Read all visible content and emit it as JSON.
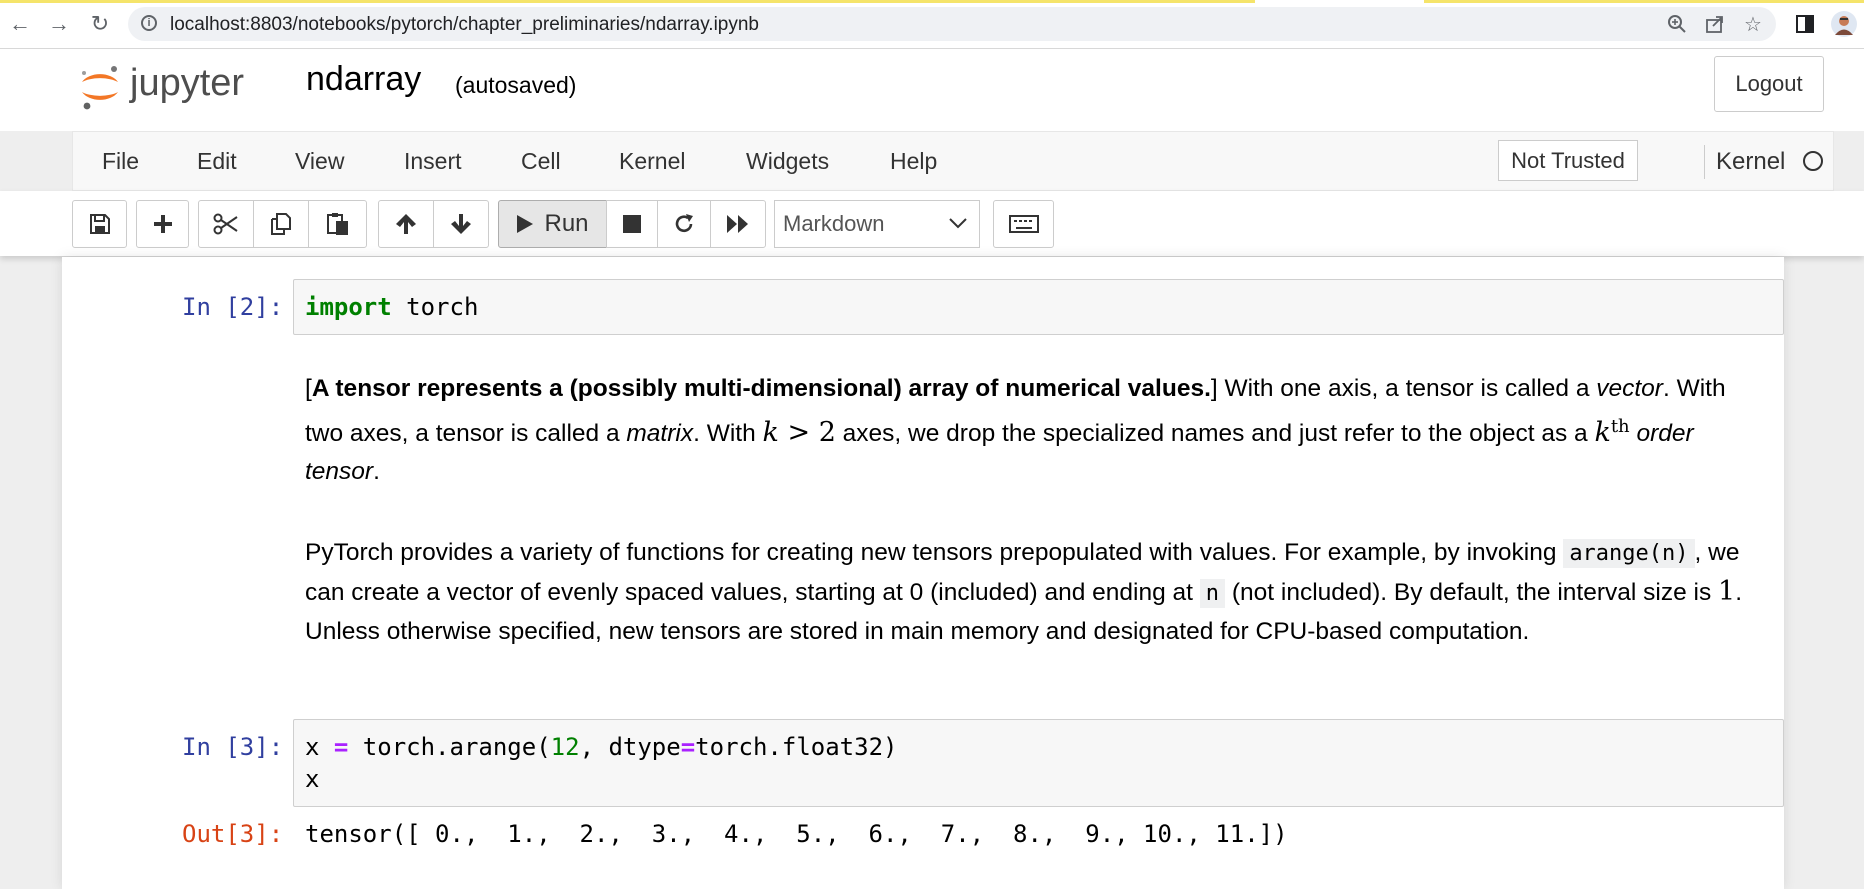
{
  "browser": {
    "url": "localhost:8803/notebooks/pytorch/chapter_preliminaries/ndarray.ipynb",
    "icons": [
      "back-icon",
      "forward-icon",
      "reload-icon",
      "info-icon",
      "zoom-icon",
      "share-icon",
      "star-icon",
      "sidepanel-icon",
      "avatar"
    ]
  },
  "header": {
    "logo_text": "jupyter",
    "notebook_name": "ndarray",
    "autosave_status": "(autosaved)",
    "logout_label": "Logout"
  },
  "menubar": {
    "items": [
      "File",
      "Edit",
      "View",
      "Insert",
      "Cell",
      "Kernel",
      "Widgets",
      "Help"
    ],
    "trust_label": "Not Trusted",
    "kernel_label": "Kernel"
  },
  "toolbar": {
    "run_label": "Run",
    "cell_type": "Markdown",
    "buttons": [
      "save-icon",
      "add-cell-icon",
      "cut-icon",
      "copy-icon",
      "paste-icon",
      "move-up-icon",
      "move-down-icon",
      "run-icon",
      "stop-icon",
      "restart-icon",
      "restart-run-all-icon",
      "keyboard-icon"
    ]
  },
  "cells": {
    "c1": {
      "prompt": "In [2]:",
      "kw": "import",
      "rest": " torch"
    },
    "md1": {
      "open_bracket": "[",
      "bold": "A tensor represents a (possibly multi-dimensional) array of numerical values.",
      "t1": "] With one axis, a tensor is called a ",
      "vector": "vector",
      "t2": ". With two axes, a tensor is called a ",
      "matrix": "matrix",
      "t3": ". With ",
      "math_k": "k",
      "math_gt": " > ",
      "math_2": "2",
      "t4": " axes, we drop the specialized names and just refer to the object as a ",
      "math_k2": "k",
      "sup": "th",
      "order_tensor": " order tensor",
      "t5": "."
    },
    "md2": {
      "t1": "PyTorch provides a variety of functions for creating new tensors prepopulated with values. For example, by invoking ",
      "code1": "arange(n)",
      "t2": ", we can create a vector of evenly spaced values, starting at 0 (included) and ending at ",
      "code2": "n",
      "t3": " (not included). By default, the interval size is ",
      "math_1": "1",
      "t4": ". Unless otherwise specified, new tensors are stored in main memory and designated for CPU-based computation."
    },
    "c2": {
      "prompt": "In [3]:",
      "line1_a": "x ",
      "line1_eq": "=",
      "line1_b": " torch.arange(",
      "line1_num": "12",
      "line1_c": ", dtype",
      "line1_eq2": "=",
      "line1_d": "torch.float32)",
      "line2": "x",
      "out_prompt": "Out[3]:",
      "output": "tensor([ 0.,  1.,  2.,  3.,  4.,  5.,  6.,  7.,  8.,  9., 10., 11.])"
    }
  },
  "colors": {
    "in_prompt": "#303f9f",
    "out_prompt": "#d84315",
    "keyword": "#008000",
    "operator": "#aa22ff",
    "logo_orange": "#f37726"
  }
}
